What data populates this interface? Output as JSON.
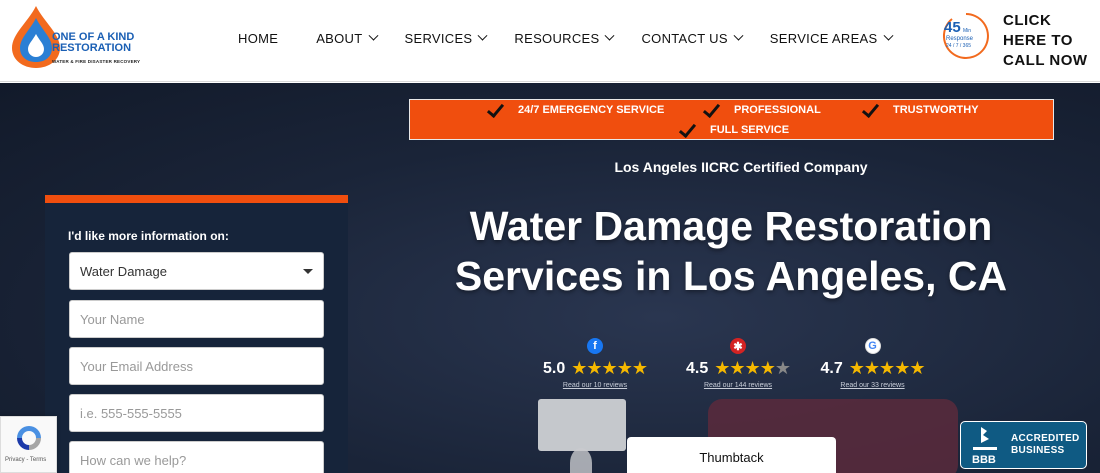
{
  "header": {
    "logo": {
      "line1": "ONE OF A KIND",
      "line2": "RESTORATION",
      "tagline": "WATER & FIRE DISASTER RECOVERY"
    },
    "nav": [
      {
        "label": "HOME",
        "has_dropdown": false
      },
      {
        "label": "ABOUT",
        "has_dropdown": true
      },
      {
        "label": "SERVICES",
        "has_dropdown": true
      },
      {
        "label": "RESOURCES",
        "has_dropdown": true
      },
      {
        "label": "CONTACT US",
        "has_dropdown": true
      },
      {
        "label": "SERVICE AREAS",
        "has_dropdown": true
      }
    ],
    "response_badge": {
      "number": "45",
      "unit": "Min",
      "label": "Response",
      "hours": "24 / 7 / 365"
    },
    "cta": {
      "line1": "CLICK",
      "line2": "HERE TO",
      "line3": "CALL NOW"
    }
  },
  "hero": {
    "banner_items": [
      "24/7 EMERGENCY SERVICE",
      "PROFESSIONAL",
      "TRUSTWORTHY",
      "FULL SERVICE"
    ],
    "certification": "Los Angeles IICRC Certified Company",
    "headline_line1": "Water Damage Restoration",
    "headline_line2": "Services in Los Angeles, CA",
    "ratings": [
      {
        "source": "facebook",
        "icon": "facebook-icon",
        "score": "5.0",
        "stars": 5,
        "link": "Read our 10 reviews",
        "color": "#1877f2"
      },
      {
        "source": "yelp",
        "icon": "yelp-icon",
        "score": "4.5",
        "stars": 4.5,
        "link": "Read our 144 reviews",
        "color": "#d32323"
      },
      {
        "source": "google",
        "icon": "google-icon",
        "score": "4.7",
        "stars": 4.7,
        "link": "Read our 33 reviews",
        "color": "#4285f4"
      }
    ],
    "thumbtack_label": "Thumbtack",
    "bbb": {
      "line1": "ACCREDITED",
      "line2": "BUSINESS",
      "mark": "BBB"
    }
  },
  "form": {
    "label": "I'd like more information on:",
    "select_value": "Water Damage",
    "name_placeholder": "Your Name",
    "email_placeholder": "Your Email Address",
    "phone_placeholder": "i.e. 555-555-5555",
    "message_placeholder": "How can we help?"
  },
  "recaptcha": {
    "text": "Privacy - Terms"
  },
  "colors": {
    "accent": "#f04e0e",
    "hero_bg": "#162033",
    "star": "#f5b800",
    "bbb": "#0f5a83"
  }
}
